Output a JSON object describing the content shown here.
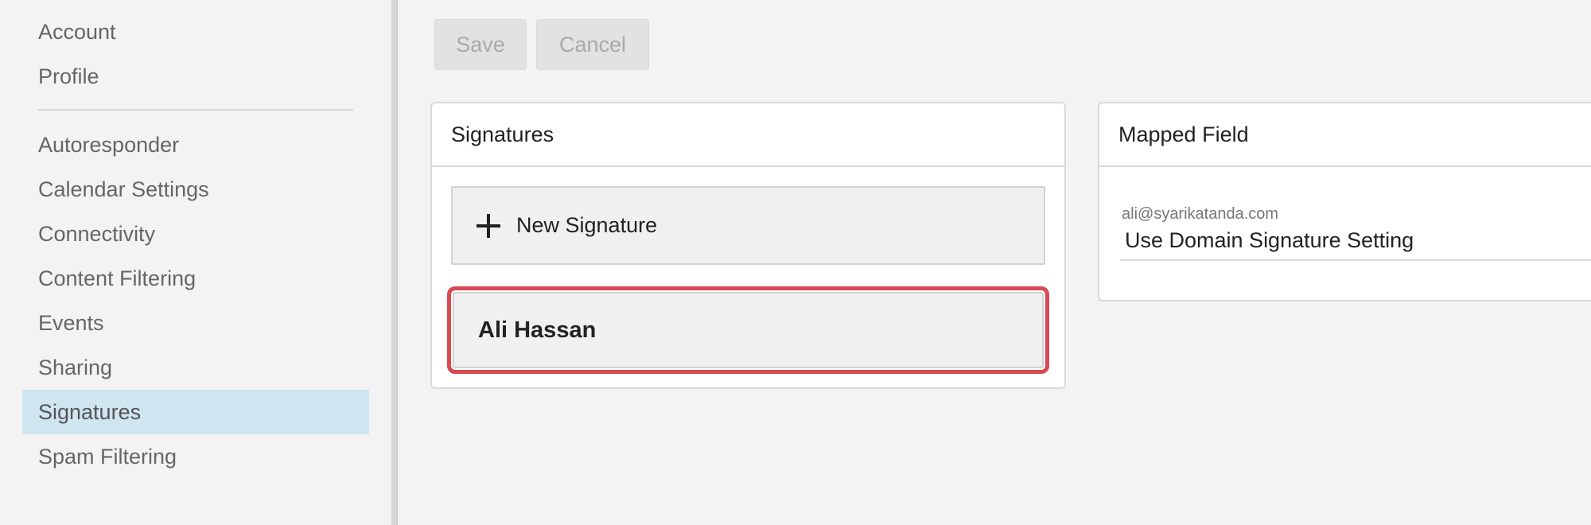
{
  "sidebar": {
    "items": [
      {
        "label": "Account"
      },
      {
        "label": "Profile"
      },
      {
        "label": "Autoresponder"
      },
      {
        "label": "Calendar Settings"
      },
      {
        "label": "Connectivity"
      },
      {
        "label": "Content Filtering"
      },
      {
        "label": "Events"
      },
      {
        "label": "Sharing"
      },
      {
        "label": "Signatures",
        "active": true
      },
      {
        "label": "Spam Filtering"
      }
    ]
  },
  "toolbar": {
    "save_label": "Save",
    "cancel_label": "Cancel"
  },
  "signatures_panel": {
    "title": "Signatures",
    "new_signature_label": "New Signature",
    "items": [
      {
        "name": "Ali Hassan",
        "selected": true
      }
    ]
  },
  "mapped_panel": {
    "title": "Mapped Field",
    "email": "ali@syarikatanda.com",
    "value": "Use Domain Signature Setting"
  },
  "colors": {
    "active_bg": "#cfe5f0",
    "selection_border": "#d84a52"
  }
}
